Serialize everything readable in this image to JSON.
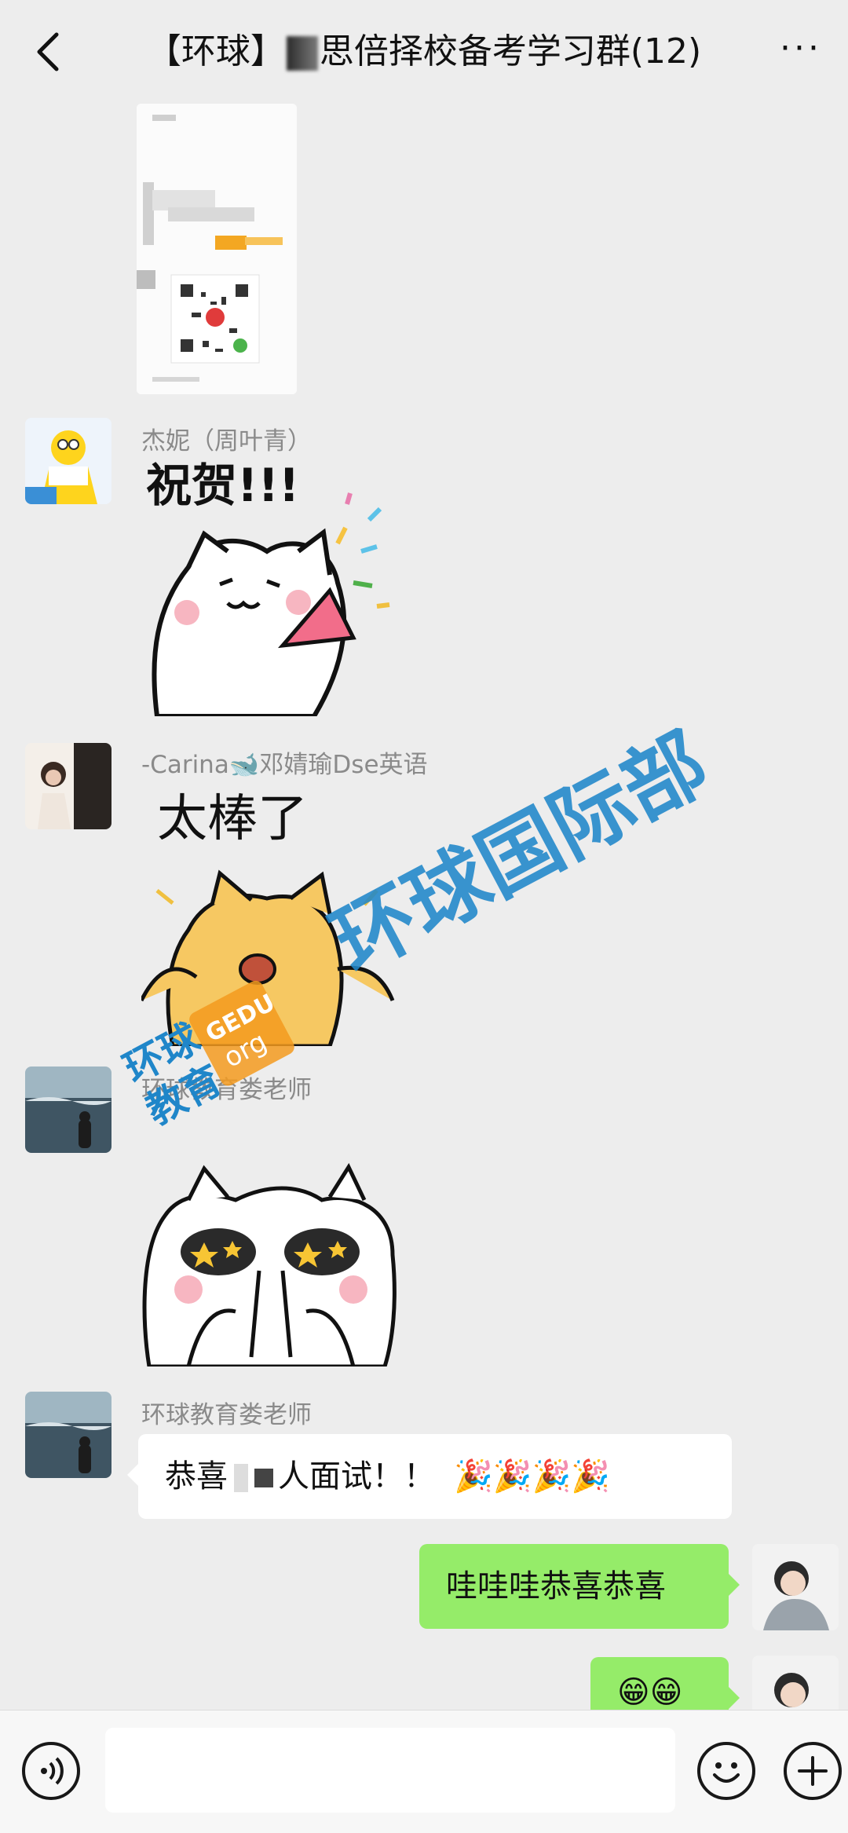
{
  "header": {
    "title_prefix": "【环球】",
    "title_suffix": "思倍择校备考学习群(12)",
    "more_label": "···"
  },
  "messages": {
    "m1": {
      "sender": "杰妮（周叶青）",
      "sticker_text": "祝贺!!!"
    },
    "m2": {
      "sender": "-Carina🐋邓婧瑜Dse英语",
      "sticker_text": "太棒了"
    },
    "m3": {
      "sender": "环球教育娄老师"
    },
    "m4": {
      "sender": "环球教育娄老师",
      "text_before": "恭喜",
      "text_after": "人面试！！",
      "emoji": "🎉🎉🎉🎉"
    },
    "m5": {
      "text": "哇哇哇恭喜恭喜"
    },
    "m6": {
      "emoji": "😁😁"
    }
  },
  "watermark": {
    "main": "环球国际部",
    "logo_line1": "环球",
    "logo_line2": "教育",
    "logo_badge_top": "GEDU",
    "logo_badge_bottom": "org"
  },
  "input": {
    "placeholder": ""
  },
  "colors": {
    "background": "#ededed",
    "my_bubble": "#95ec69",
    "watermark": "#1f86c9",
    "logo_orange": "#f39a1e"
  }
}
